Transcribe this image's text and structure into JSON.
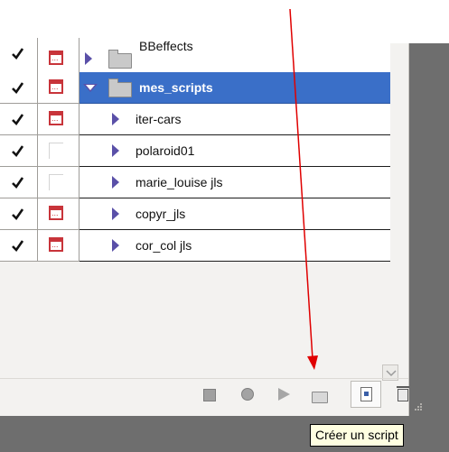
{
  "actions": [
    {
      "name": "BBeffects",
      "checked": true,
      "dialog": true,
      "expanded": false,
      "type": "set",
      "selected": false,
      "partial": true
    },
    {
      "name": "mes_scripts",
      "checked": true,
      "dialog": true,
      "expanded": true,
      "type": "set",
      "selected": true
    },
    {
      "name": "iter-cars",
      "checked": true,
      "dialog": true,
      "type": "action"
    },
    {
      "name": "polaroid01",
      "checked": true,
      "dialog": false,
      "type": "action"
    },
    {
      "name": "marie_louise jls",
      "checked": true,
      "dialog": false,
      "type": "action"
    },
    {
      "name": "copyr_jls",
      "checked": true,
      "dialog": true,
      "type": "action"
    },
    {
      "name": "cor_col jls",
      "checked": true,
      "dialog": true,
      "type": "action"
    }
  ],
  "toolbar": {
    "stop_icon": "stop-icon",
    "record_icon": "record-icon",
    "play_icon": "play-icon",
    "new_set_icon": "folder-icon",
    "new_action_icon": "new-document-icon",
    "delete_icon": "trash-icon"
  },
  "tooltip": {
    "text": "Créer un script"
  },
  "colors": {
    "selection": "#3a6fc8",
    "annotation_arrow": "#e00000",
    "dialog_icon": "#c8343a",
    "triangle": "#5a50a8"
  }
}
